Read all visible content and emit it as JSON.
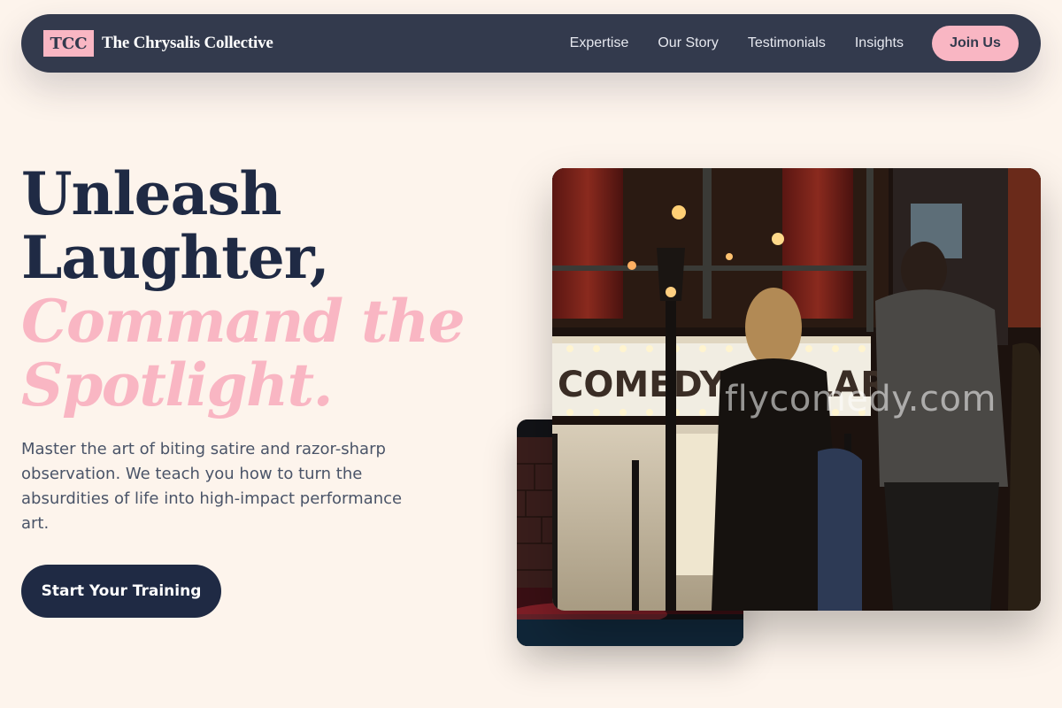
{
  "nav": {
    "logo_text": "TCC",
    "brand_name": "The Chrysalis Collective",
    "links": [
      "Expertise",
      "Our Story",
      "Testimonials",
      "Insights"
    ],
    "cta_label": "Join Us"
  },
  "hero": {
    "headline_line1": "Unleash",
    "headline_line2": "Laughter,",
    "headline_accent_line1": "Command the",
    "headline_accent_line2": "Spotlight.",
    "description": "Master the art of biting satire and razor-sharp observation. We teach you how to turn the absurdities of life into high-impact performance art.",
    "cta_label": "Start Your Training"
  },
  "photos": {
    "main_watermark": "flycomedy.com",
    "marquee_text": "COMEDY CELLAR"
  },
  "colors": {
    "background": "#fdf4ec",
    "navbar": "#333a4d",
    "accent_pink": "#f9b6c3",
    "headline_dark": "#1f2a44",
    "body_text": "#4a5468"
  }
}
